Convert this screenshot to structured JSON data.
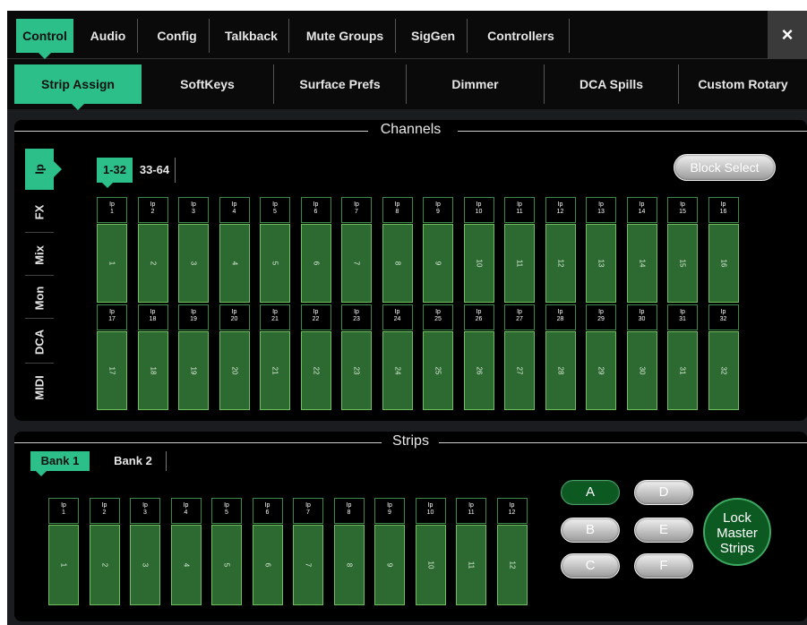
{
  "tabs": [
    "Control",
    "Audio",
    "Config",
    "Talkback",
    "Mute Groups",
    "SigGen",
    "Controllers"
  ],
  "close_label": "×",
  "subtabs": [
    "Strip Assign",
    "SoftKeys",
    "Surface Prefs",
    "Dimmer",
    "DCA Spills",
    "Custom Rotary"
  ],
  "channels": {
    "title": "Channels",
    "side_tabs": [
      "Ip",
      "FX",
      "Mix",
      "Mon",
      "DCA",
      "MIDI"
    ],
    "ranges": [
      "1-32",
      "33-64"
    ],
    "block_select": "Block Select",
    "prefix": "Ip",
    "row1": [
      "1",
      "2",
      "3",
      "4",
      "5",
      "6",
      "7",
      "8",
      "9",
      "10",
      "11",
      "12",
      "13",
      "14",
      "15",
      "16"
    ],
    "row2": [
      "17",
      "18",
      "19",
      "20",
      "21",
      "22",
      "23",
      "24",
      "25",
      "26",
      "27",
      "28",
      "29",
      "30",
      "31",
      "32"
    ]
  },
  "strips": {
    "title": "Strips",
    "banks": [
      "Bank 1",
      "Bank 2"
    ],
    "prefix": "Ip",
    "items": [
      "1",
      "2",
      "3",
      "4",
      "5",
      "6",
      "7",
      "8",
      "9",
      "10",
      "11",
      "12"
    ],
    "layers": [
      "A",
      "B",
      "C",
      "D",
      "E",
      "F"
    ],
    "lock_label": "Lock Master Strips"
  },
  "colors": {
    "accent": "#2dbf8a",
    "fader": "#2d6a31",
    "fader_border": "#6fbf5c"
  }
}
